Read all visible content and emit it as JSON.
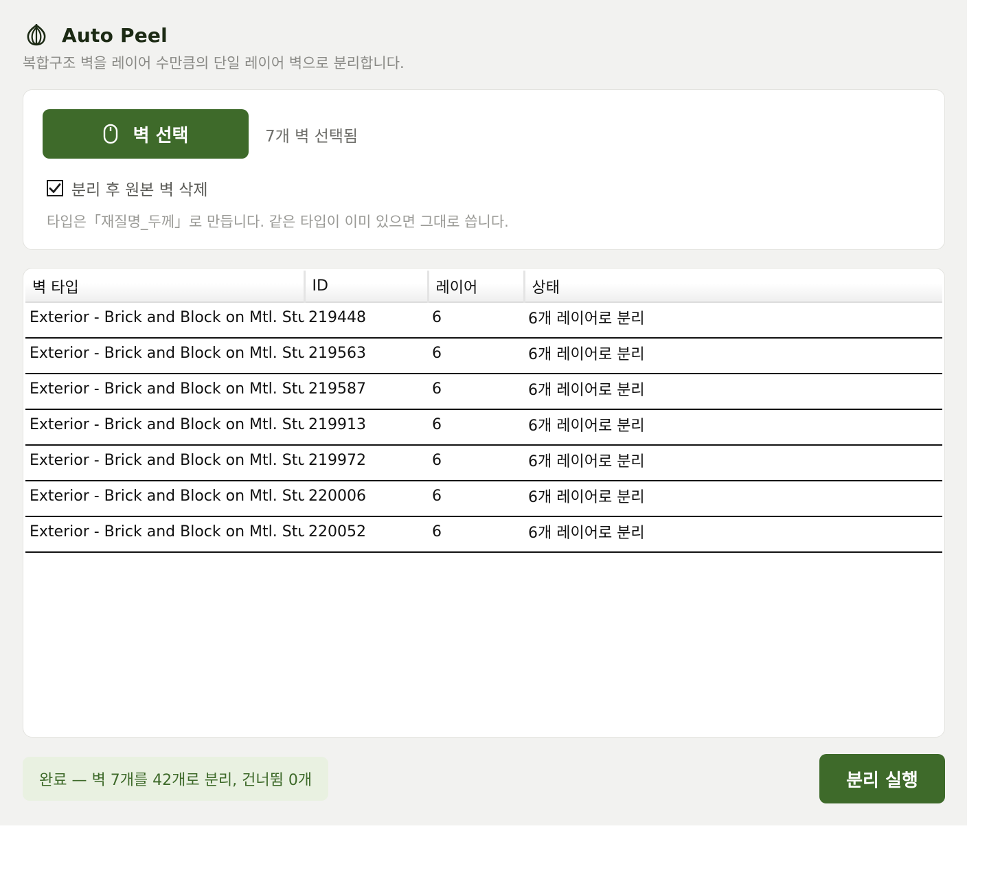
{
  "app": {
    "title": "Auto Peel",
    "subtitle": "복합구조 벽을 레이어 수만큼의 단일 레이어 벽으로 분리합니다.",
    "logo_icon": "onion-icon"
  },
  "selection": {
    "select_button_label": "벽 선택",
    "select_button_icon": "mouse-icon",
    "selected_count_text": "7개 벽 선택됨",
    "delete_original_label": "분리 후 원본 벽 삭제",
    "delete_original_checked": true,
    "hint": "타입은「재질명_두께」로 만듭니다. 같은 타입이 이미 있으면 그대로 씁니다."
  },
  "table": {
    "columns": [
      "벽 타입",
      "ID",
      "레이어",
      "상태"
    ],
    "rows": [
      {
        "type": "Exterior - Brick and Block on Mtl. Stuc",
        "id": "219448",
        "layers": "6",
        "status": "6개 레이어로 분리"
      },
      {
        "type": "Exterior - Brick and Block on Mtl. Stuc",
        "id": "219563",
        "layers": "6",
        "status": "6개 레이어로 분리"
      },
      {
        "type": "Exterior - Brick and Block on Mtl. Stuc",
        "id": "219587",
        "layers": "6",
        "status": "6개 레이어로 분리"
      },
      {
        "type": "Exterior - Brick and Block on Mtl. Stuc",
        "id": "219913",
        "layers": "6",
        "status": "6개 레이어로 분리"
      },
      {
        "type": "Exterior - Brick and Block on Mtl. Stuc",
        "id": "219972",
        "layers": "6",
        "status": "6개 레이어로 분리"
      },
      {
        "type": "Exterior - Brick and Block on Mtl. Stuc",
        "id": "220006",
        "layers": "6",
        "status": "6개 레이어로 분리"
      },
      {
        "type": "Exterior - Brick and Block on Mtl. Stuc",
        "id": "220052",
        "layers": "6",
        "status": "6개 레이어로 분리"
      }
    ]
  },
  "footer": {
    "status_message": "완료 — 벽 7개를 42개로 분리, 건너뜀 0개",
    "run_button_label": "분리 실행"
  },
  "colors": {
    "accent": "#3e6a2a",
    "background": "#f2f2f0",
    "status_bg": "#e9f1e1"
  }
}
